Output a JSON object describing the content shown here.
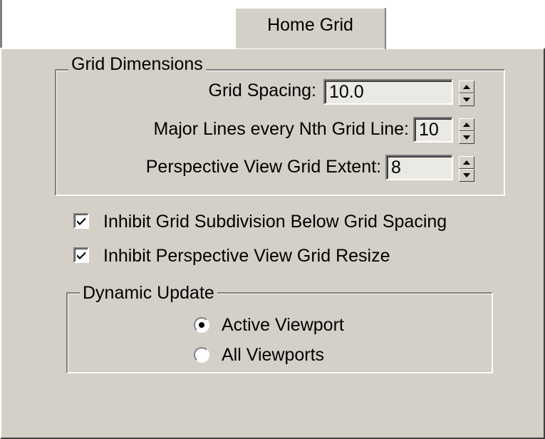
{
  "tab": {
    "label": "Home Grid"
  },
  "grid_dimensions": {
    "title": "Grid Dimensions",
    "grid_spacing": {
      "label": "Grid Spacing:",
      "value": "10.0"
    },
    "major_lines": {
      "label": "Major Lines every Nth Grid Line:",
      "value": "10"
    },
    "perspective_extent": {
      "label": "Perspective View Grid Extent:",
      "value": "8"
    }
  },
  "options": {
    "inhibit_subdivision": {
      "label": "Inhibit Grid Subdivision Below Grid Spacing",
      "checked": true
    },
    "inhibit_resize": {
      "label": "Inhibit Perspective View Grid Resize",
      "checked": true
    }
  },
  "dynamic_update": {
    "title": "Dynamic Update",
    "active_viewport": {
      "label": "Active Viewport",
      "selected": true
    },
    "all_viewports": {
      "label": "All Viewports",
      "selected": false
    }
  },
  "colors": {
    "panel": "#d4d0c8",
    "highlight": "#ffffff",
    "shadow": "#808080",
    "dark_shadow": "#404040"
  }
}
